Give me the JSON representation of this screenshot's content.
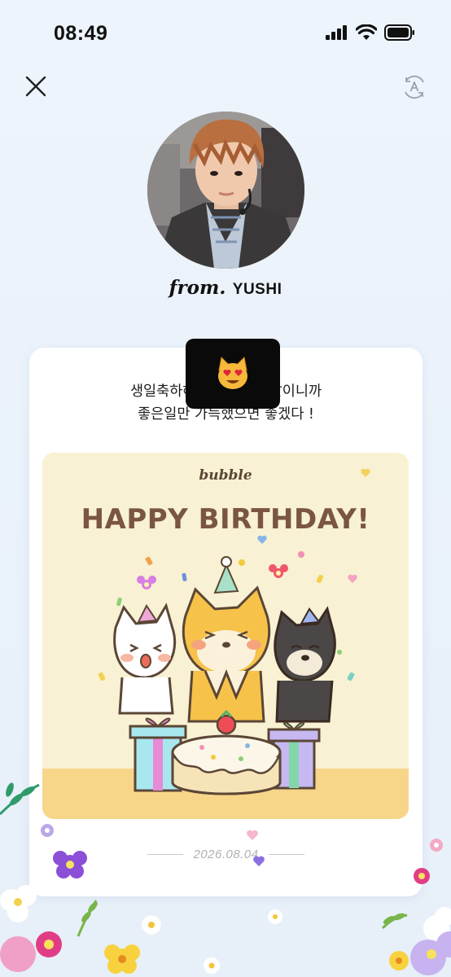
{
  "status_bar": {
    "time": "08:49"
  },
  "profile": {
    "from_prefix": "from.",
    "name": "YUSHI"
  },
  "message": {
    "line1": "생일축하해요~ 특별한 날이니까",
    "line2": "좋은일만 가득했으면 좋겠다 !"
  },
  "birthday_card": {
    "brand": "bubble",
    "title": "HAPPY BIRTHDAY!"
  },
  "date": "2026.08.04",
  "icons": {
    "close": "close-icon",
    "translate": "translate-icon",
    "emoji": "heart-eyes-cat-emoji"
  },
  "colors": {
    "background": "#eef4fb",
    "card_title": "#7a5641",
    "card_bg": "#f8f1d3"
  }
}
